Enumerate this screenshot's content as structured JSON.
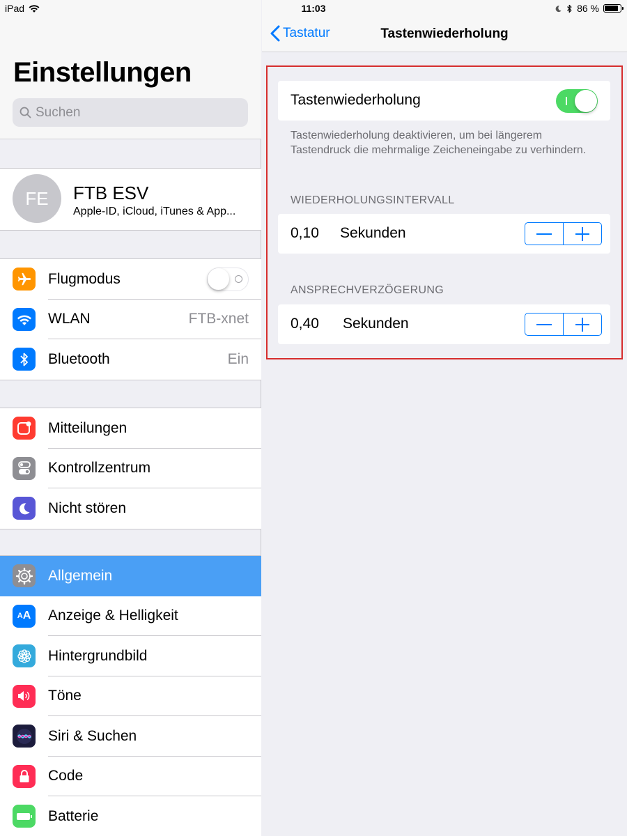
{
  "status": {
    "device": "iPad",
    "time": "11:03",
    "battery": "86 %",
    "battery_level": 0.86
  },
  "sidebar": {
    "title": "Einstellungen",
    "search_placeholder": "Suchen",
    "profile": {
      "initials": "FE",
      "name": "FTB ESV",
      "subtitle": "Apple-ID, iCloud, iTunes & App..."
    },
    "connectivity": [
      {
        "label": "Flugmodus",
        "value": "",
        "icon": "airplane-icon",
        "color": "#ff9500"
      },
      {
        "label": "WLAN",
        "value": "FTB-xnet",
        "icon": "wifi-icon",
        "color": "#007aff"
      },
      {
        "label": "Bluetooth",
        "value": "Ein",
        "icon": "bluetooth-icon",
        "color": "#007aff"
      }
    ],
    "notifications": [
      {
        "label": "Mitteilungen",
        "icon": "notifications-icon",
        "color": "#ff3b30"
      },
      {
        "label": "Kontrollzentrum",
        "icon": "control-center-icon",
        "color": "#8e8e93"
      },
      {
        "label": "Nicht stören",
        "icon": "moon-icon",
        "color": "#5856d6"
      }
    ],
    "general": [
      {
        "label": "Allgemein",
        "icon": "gear-icon",
        "color": "#8e8e93"
      },
      {
        "label": "Anzeige & Helligkeit",
        "icon": "display-icon",
        "color": "#007aff"
      },
      {
        "label": "Hintergrundbild",
        "icon": "wallpaper-icon",
        "color": "#34aadc"
      },
      {
        "label": "Töne",
        "icon": "sound-icon",
        "color": "#ff2d55"
      },
      {
        "label": "Siri & Suchen",
        "icon": "siri-icon",
        "color": "#1c1c3c"
      },
      {
        "label": "Code",
        "icon": "lock-icon",
        "color": "#ff2d55"
      },
      {
        "label": "Batterie",
        "icon": "battery-icon",
        "color": "#4cd964"
      }
    ]
  },
  "detail": {
    "back_label": "Tastatur",
    "title": "Tastenwiederholung",
    "toggle_label": "Tastenwiederholung",
    "toggle_on": true,
    "note": "Tastenwiederholung deaktivieren, um bei längerem Tastendruck die mehrmalige Zeicheneingabe zu verhindern.",
    "interval": {
      "header": "WIEDERHOLUNGSINTERVALL",
      "value": "0,10",
      "unit": "Sekunden"
    },
    "delay": {
      "header": "ANSPRECHVERZÖGERUNG",
      "value": "0,40",
      "unit": "Sekunden"
    }
  }
}
